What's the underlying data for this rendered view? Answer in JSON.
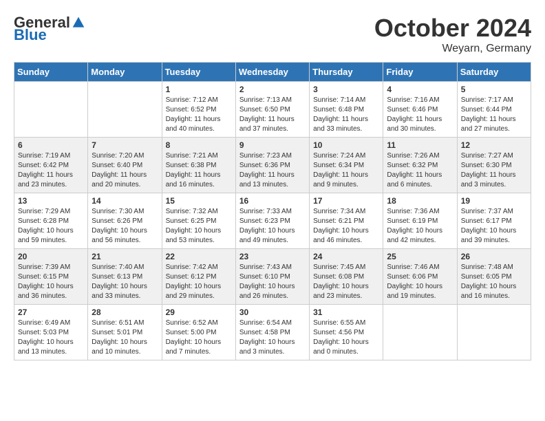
{
  "header": {
    "logo_general": "General",
    "logo_blue": "Blue",
    "month_title": "October 2024",
    "location": "Weyarn, Germany"
  },
  "weekdays": [
    "Sunday",
    "Monday",
    "Tuesday",
    "Wednesday",
    "Thursday",
    "Friday",
    "Saturday"
  ],
  "weeks": [
    [
      {
        "day": "",
        "sunrise": "",
        "sunset": "",
        "daylight": ""
      },
      {
        "day": "",
        "sunrise": "",
        "sunset": "",
        "daylight": ""
      },
      {
        "day": "1",
        "sunrise": "Sunrise: 7:12 AM",
        "sunset": "Sunset: 6:52 PM",
        "daylight": "Daylight: 11 hours and 40 minutes."
      },
      {
        "day": "2",
        "sunrise": "Sunrise: 7:13 AM",
        "sunset": "Sunset: 6:50 PM",
        "daylight": "Daylight: 11 hours and 37 minutes."
      },
      {
        "day": "3",
        "sunrise": "Sunrise: 7:14 AM",
        "sunset": "Sunset: 6:48 PM",
        "daylight": "Daylight: 11 hours and 33 minutes."
      },
      {
        "day": "4",
        "sunrise": "Sunrise: 7:16 AM",
        "sunset": "Sunset: 6:46 PM",
        "daylight": "Daylight: 11 hours and 30 minutes."
      },
      {
        "day": "5",
        "sunrise": "Sunrise: 7:17 AM",
        "sunset": "Sunset: 6:44 PM",
        "daylight": "Daylight: 11 hours and 27 minutes."
      }
    ],
    [
      {
        "day": "6",
        "sunrise": "Sunrise: 7:19 AM",
        "sunset": "Sunset: 6:42 PM",
        "daylight": "Daylight: 11 hours and 23 minutes."
      },
      {
        "day": "7",
        "sunrise": "Sunrise: 7:20 AM",
        "sunset": "Sunset: 6:40 PM",
        "daylight": "Daylight: 11 hours and 20 minutes."
      },
      {
        "day": "8",
        "sunrise": "Sunrise: 7:21 AM",
        "sunset": "Sunset: 6:38 PM",
        "daylight": "Daylight: 11 hours and 16 minutes."
      },
      {
        "day": "9",
        "sunrise": "Sunrise: 7:23 AM",
        "sunset": "Sunset: 6:36 PM",
        "daylight": "Daylight: 11 hours and 13 minutes."
      },
      {
        "day": "10",
        "sunrise": "Sunrise: 7:24 AM",
        "sunset": "Sunset: 6:34 PM",
        "daylight": "Daylight: 11 hours and 9 minutes."
      },
      {
        "day": "11",
        "sunrise": "Sunrise: 7:26 AM",
        "sunset": "Sunset: 6:32 PM",
        "daylight": "Daylight: 11 hours and 6 minutes."
      },
      {
        "day": "12",
        "sunrise": "Sunrise: 7:27 AM",
        "sunset": "Sunset: 6:30 PM",
        "daylight": "Daylight: 11 hours and 3 minutes."
      }
    ],
    [
      {
        "day": "13",
        "sunrise": "Sunrise: 7:29 AM",
        "sunset": "Sunset: 6:28 PM",
        "daylight": "Daylight: 10 hours and 59 minutes."
      },
      {
        "day": "14",
        "sunrise": "Sunrise: 7:30 AM",
        "sunset": "Sunset: 6:26 PM",
        "daylight": "Daylight: 10 hours and 56 minutes."
      },
      {
        "day": "15",
        "sunrise": "Sunrise: 7:32 AM",
        "sunset": "Sunset: 6:25 PM",
        "daylight": "Daylight: 10 hours and 53 minutes."
      },
      {
        "day": "16",
        "sunrise": "Sunrise: 7:33 AM",
        "sunset": "Sunset: 6:23 PM",
        "daylight": "Daylight: 10 hours and 49 minutes."
      },
      {
        "day": "17",
        "sunrise": "Sunrise: 7:34 AM",
        "sunset": "Sunset: 6:21 PM",
        "daylight": "Daylight: 10 hours and 46 minutes."
      },
      {
        "day": "18",
        "sunrise": "Sunrise: 7:36 AM",
        "sunset": "Sunset: 6:19 PM",
        "daylight": "Daylight: 10 hours and 42 minutes."
      },
      {
        "day": "19",
        "sunrise": "Sunrise: 7:37 AM",
        "sunset": "Sunset: 6:17 PM",
        "daylight": "Daylight: 10 hours and 39 minutes."
      }
    ],
    [
      {
        "day": "20",
        "sunrise": "Sunrise: 7:39 AM",
        "sunset": "Sunset: 6:15 PM",
        "daylight": "Daylight: 10 hours and 36 minutes."
      },
      {
        "day": "21",
        "sunrise": "Sunrise: 7:40 AM",
        "sunset": "Sunset: 6:13 PM",
        "daylight": "Daylight: 10 hours and 33 minutes."
      },
      {
        "day": "22",
        "sunrise": "Sunrise: 7:42 AM",
        "sunset": "Sunset: 6:12 PM",
        "daylight": "Daylight: 10 hours and 29 minutes."
      },
      {
        "day": "23",
        "sunrise": "Sunrise: 7:43 AM",
        "sunset": "Sunset: 6:10 PM",
        "daylight": "Daylight: 10 hours and 26 minutes."
      },
      {
        "day": "24",
        "sunrise": "Sunrise: 7:45 AM",
        "sunset": "Sunset: 6:08 PM",
        "daylight": "Daylight: 10 hours and 23 minutes."
      },
      {
        "day": "25",
        "sunrise": "Sunrise: 7:46 AM",
        "sunset": "Sunset: 6:06 PM",
        "daylight": "Daylight: 10 hours and 19 minutes."
      },
      {
        "day": "26",
        "sunrise": "Sunrise: 7:48 AM",
        "sunset": "Sunset: 6:05 PM",
        "daylight": "Daylight: 10 hours and 16 minutes."
      }
    ],
    [
      {
        "day": "27",
        "sunrise": "Sunrise: 6:49 AM",
        "sunset": "Sunset: 5:03 PM",
        "daylight": "Daylight: 10 hours and 13 minutes."
      },
      {
        "day": "28",
        "sunrise": "Sunrise: 6:51 AM",
        "sunset": "Sunset: 5:01 PM",
        "daylight": "Daylight: 10 hours and 10 minutes."
      },
      {
        "day": "29",
        "sunrise": "Sunrise: 6:52 AM",
        "sunset": "Sunset: 5:00 PM",
        "daylight": "Daylight: 10 hours and 7 minutes."
      },
      {
        "day": "30",
        "sunrise": "Sunrise: 6:54 AM",
        "sunset": "Sunset: 4:58 PM",
        "daylight": "Daylight: 10 hours and 3 minutes."
      },
      {
        "day": "31",
        "sunrise": "Sunrise: 6:55 AM",
        "sunset": "Sunset: 4:56 PM",
        "daylight": "Daylight: 10 hours and 0 minutes."
      },
      {
        "day": "",
        "sunrise": "",
        "sunset": "",
        "daylight": ""
      },
      {
        "day": "",
        "sunrise": "",
        "sunset": "",
        "daylight": ""
      }
    ]
  ]
}
